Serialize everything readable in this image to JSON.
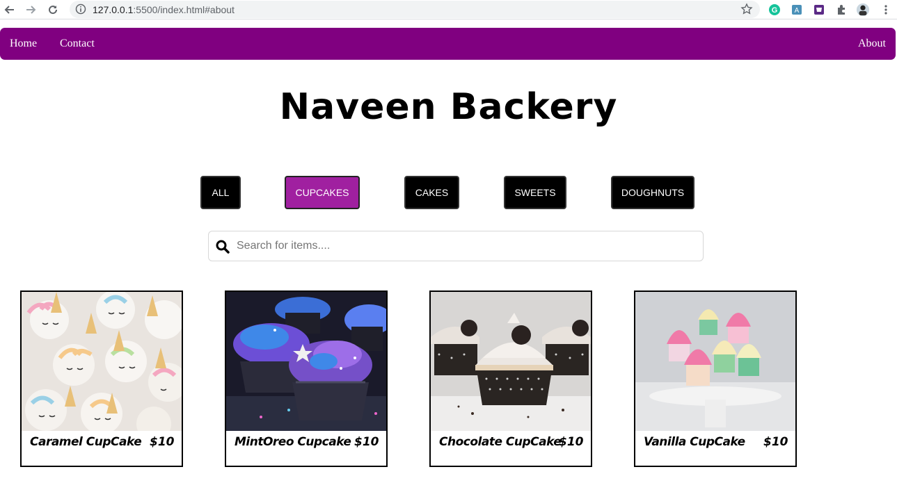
{
  "browser": {
    "url_host": "127.0.0.1",
    "url_rest": ":5500/index.html#about",
    "icons": [
      "back-icon",
      "forward-icon",
      "reload-icon",
      "info-icon",
      "star-icon",
      "grammarly-icon",
      "extension-a-icon",
      "extension-purple-icon",
      "puzzle-icon",
      "profile-avatar",
      "menu-dots-icon"
    ]
  },
  "navbar": {
    "home": "Home",
    "contact": "Contact",
    "about": "About",
    "color": "#800080"
  },
  "title": "Naveen Backery",
  "filters": [
    {
      "label": "ALL",
      "active": false
    },
    {
      "label": "CUPCAKES",
      "active": true
    },
    {
      "label": "CAKES",
      "active": false
    },
    {
      "label": "SWEETS",
      "active": false
    },
    {
      "label": "DOUGHNUTS",
      "active": false
    }
  ],
  "search": {
    "placeholder": "Search for items...."
  },
  "items": [
    {
      "name": "Caramel CupCake",
      "price": "$10",
      "image": "unicorn-cupcakes"
    },
    {
      "name": "MintOreo Cupcake",
      "price": "$10",
      "image": "galaxy-cupcakes"
    },
    {
      "name": "Chocolate CupCake",
      "price": "$10",
      "image": "oreo-cupcakes"
    },
    {
      "name": "Vanilla CupCake",
      "price": "$10",
      "image": "pink-vanilla-cupcakes"
    }
  ],
  "colors": {
    "accent": "#800080",
    "active_filter": "#a020a0"
  }
}
